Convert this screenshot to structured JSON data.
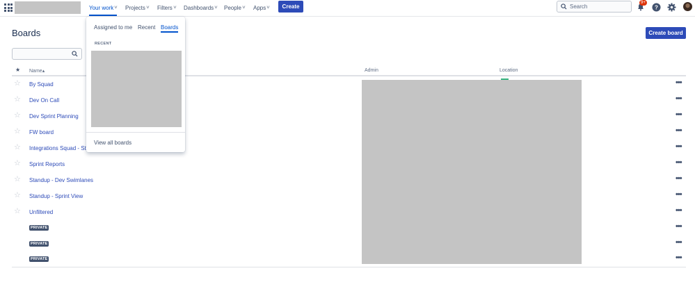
{
  "nav": {
    "items": [
      {
        "label": "Your work",
        "active": true
      },
      {
        "label": "Projects",
        "active": false
      },
      {
        "label": "Filters",
        "active": false
      },
      {
        "label": "Dashboards",
        "active": false
      },
      {
        "label": "People",
        "active": false
      },
      {
        "label": "Apps",
        "active": false
      }
    ],
    "create_label": "Create",
    "search_placeholder": "Search",
    "notification_badge": "9+",
    "icons": [
      "app-switcher-icon",
      "search-icon",
      "notification-icon",
      "help-icon",
      "settings-icon"
    ]
  },
  "dropdown": {
    "tabs": [
      {
        "label": "Assigned to me",
        "active": false
      },
      {
        "label": "Recent",
        "active": false
      },
      {
        "label": "Boards",
        "active": true
      }
    ],
    "section_label": "RECENT",
    "footer_link": "View all boards"
  },
  "page": {
    "title": "Boards",
    "create_board_label": "Create board",
    "search_value": ""
  },
  "table": {
    "headers": {
      "star": "★",
      "name": "Name",
      "name_sort": "▴",
      "admin": "Admin",
      "location": "Location"
    },
    "rows": [
      {
        "name": "By Squad",
        "private": false
      },
      {
        "name": "Dev On Call",
        "private": false
      },
      {
        "name": "Dev Sprint Planning",
        "private": false
      },
      {
        "name": "FW board",
        "private": false
      },
      {
        "name": "Integrations Squad - Sta",
        "private": false
      },
      {
        "name": "Sprint Reports",
        "private": false
      },
      {
        "name": "Standup - Dev Swimlanes",
        "private": false
      },
      {
        "name": "Standup - Sprint View",
        "private": false
      },
      {
        "name": "Unfiltered",
        "private": false
      },
      {
        "name": "PRIVATE",
        "private": true
      },
      {
        "name": "PRIVATE",
        "private": true
      },
      {
        "name": "PRIVATE",
        "private": true
      }
    ],
    "more_label": "•••",
    "star_glyph": "☆"
  },
  "colors": {
    "primary": "#2d4bb8",
    "link": "#2d4bb8",
    "active_tab": "#0052cc",
    "badge": "#de350b"
  }
}
